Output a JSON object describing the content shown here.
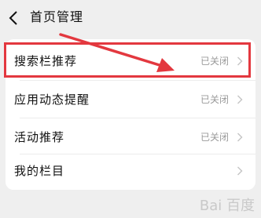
{
  "header": {
    "title": "首页管理",
    "back_icon": "chevron-left-icon"
  },
  "rows": [
    {
      "label": "搜索栏推荐",
      "status": "已关闭",
      "highlighted": true
    },
    {
      "label": "应用动态提醒",
      "status": "已关闭"
    },
    {
      "label": "活动推荐",
      "status": "已关闭"
    },
    {
      "label": "我的栏目",
      "status": ""
    }
  ],
  "colors": {
    "background": "#efefef",
    "card": "#ffffff",
    "annotation_red": "#e3383f",
    "status_gray": "#9a9a9a"
  }
}
